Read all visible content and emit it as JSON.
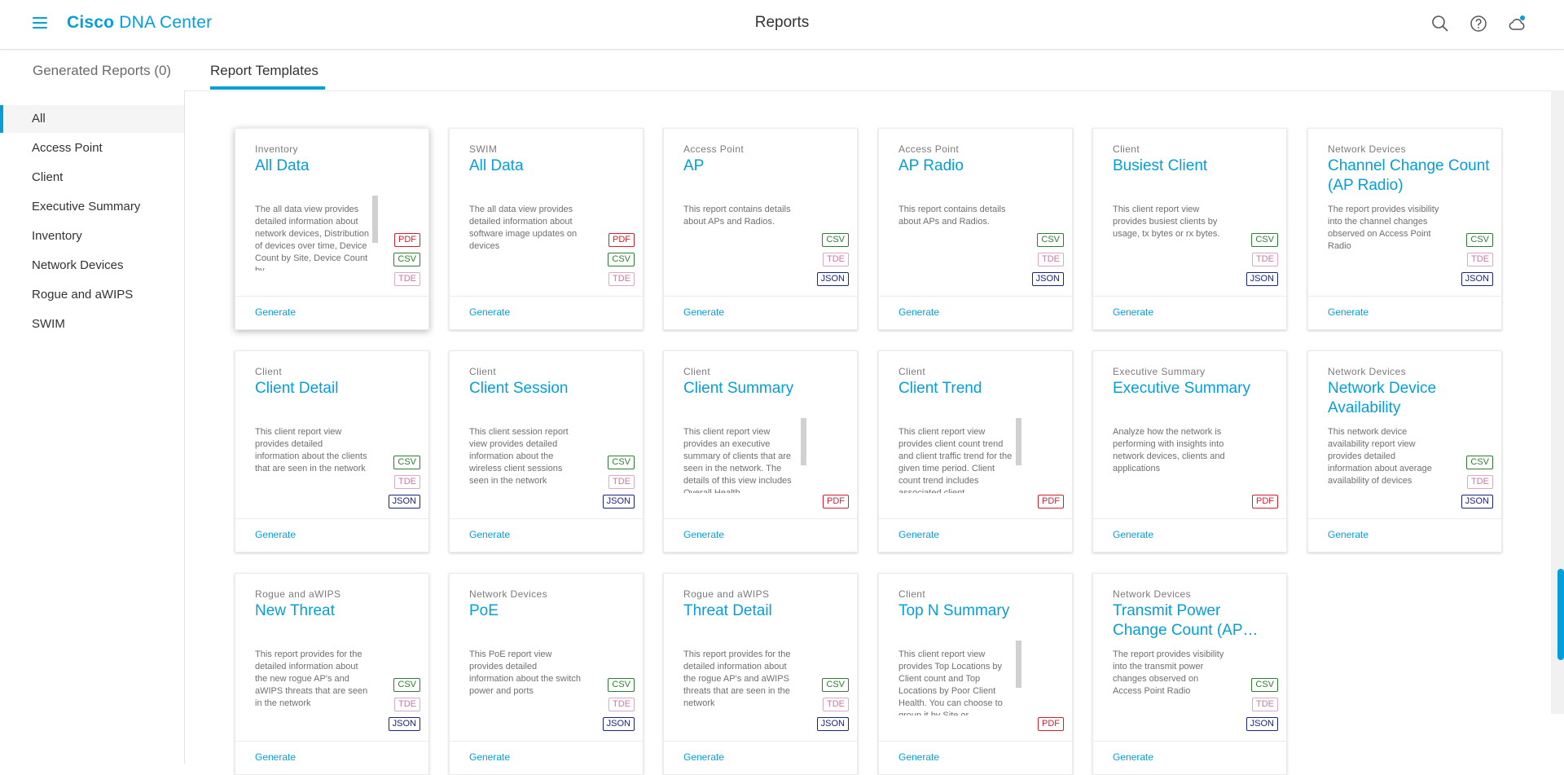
{
  "header": {
    "brand_bold": "Cisco",
    "brand_rest": " DNA Center",
    "page_title": "Reports"
  },
  "icons": {
    "menu": "hamburger-menu-icon",
    "search": "search-icon",
    "help": "help-icon",
    "notifications": "cloud-notification-icon"
  },
  "tabs": [
    {
      "label": "Generated Reports (0)"
    },
    {
      "label": "Report Templates"
    }
  ],
  "sidebar": {
    "items": [
      {
        "label": "All"
      },
      {
        "label": "Access Point"
      },
      {
        "label": "Client"
      },
      {
        "label": "Executive Summary"
      },
      {
        "label": "Inventory"
      },
      {
        "label": "Network Devices"
      },
      {
        "label": "Rogue and aWIPS"
      },
      {
        "label": "SWIM"
      }
    ]
  },
  "colors": {
    "accent": "#049fd9",
    "pdf": "#cf2030",
    "csv": "#2e7d32",
    "tde": "#c678a4",
    "json": "#1a237e"
  },
  "cards": [
    {
      "category": "Inventory",
      "title": "All Data",
      "description": "The all data view provides detailed information about network devices, Distribution of devices over time, Device Count by Site, Device Count by",
      "formats": [
        "PDF",
        "CSV",
        "TDE"
      ],
      "action": "Generate"
    },
    {
      "category": "SWIM",
      "title": "All Data",
      "description": "The all data view provides detailed information about software image updates on devices",
      "formats": [
        "PDF",
        "CSV",
        "TDE"
      ],
      "action": "Generate"
    },
    {
      "category": "Access Point",
      "title": "AP",
      "description": "This report contains details about APs and Radios.",
      "formats": [
        "CSV",
        "TDE",
        "JSON"
      ],
      "action": "Generate"
    },
    {
      "category": "Access Point",
      "title": "AP Radio",
      "description": "This report contains details about APs and Radios.",
      "formats": [
        "CSV",
        "TDE",
        "JSON"
      ],
      "action": "Generate"
    },
    {
      "category": "Client",
      "title": "Busiest Client",
      "description": "This client report view provides busiest clients by usage, tx bytes or rx bytes.",
      "formats": [
        "CSV",
        "TDE",
        "JSON"
      ],
      "action": "Generate"
    },
    {
      "category": "Network Devices",
      "title": "Channel Change Count (AP Radio)",
      "description": "The report provides visibility into the channel changes observed on Access Point Radio",
      "formats": [
        "CSV",
        "TDE",
        "JSON"
      ],
      "action": "Generate"
    },
    {
      "category": "Client",
      "title": "Client Detail",
      "description": "This client report view provides detailed information about the clients that are seen in the network",
      "formats": [
        "CSV",
        "TDE",
        "JSON"
      ],
      "action": "Generate"
    },
    {
      "category": "Client",
      "title": "Client Session",
      "description": "This client session report view provides detailed information about the wireless client sessions seen in the network",
      "formats": [
        "CSV",
        "TDE",
        "JSON"
      ],
      "action": "Generate"
    },
    {
      "category": "Client",
      "title": "Client Summary",
      "description": "This client report view provides an executive summary of clients that are seen in the network. The details of this view includes Overall Health",
      "formats": [
        "PDF"
      ],
      "action": "Generate"
    },
    {
      "category": "Client",
      "title": "Client Trend",
      "description": "This client report view provides client count trend and client traffic trend for the given time period. Client count trend includes associated client",
      "formats": [
        "PDF"
      ],
      "action": "Generate"
    },
    {
      "category": "Executive Summary",
      "title": "Executive Summary",
      "description": "Analyze how the network is performing with insights into network devices, clients and applications",
      "formats": [
        "PDF"
      ],
      "action": "Generate"
    },
    {
      "category": "Network Devices",
      "title": "Network Device Availability",
      "description": "This network device availability report view provides detailed information about average availability of devices",
      "formats": [
        "CSV",
        "TDE",
        "JSON"
      ],
      "action": "Generate"
    },
    {
      "category": "Rogue and aWIPS",
      "title": "New Threat",
      "description": "This report provides for the detailed information about the new rogue AP's and aWIPS threats that are seen in the network",
      "formats": [
        "CSV",
        "TDE",
        "JSON"
      ],
      "action": "Generate"
    },
    {
      "category": "Network Devices",
      "title": "PoE",
      "description": "This PoE report view provides detailed information about the switch power and ports",
      "formats": [
        "CSV",
        "TDE",
        "JSON"
      ],
      "action": "Generate"
    },
    {
      "category": "Rogue and aWIPS",
      "title": "Threat Detail",
      "description": "This report provides for the detailed information about the rogue AP's and aWIPS threats that are seen in the network",
      "formats": [
        "CSV",
        "TDE",
        "JSON"
      ],
      "action": "Generate"
    },
    {
      "category": "Client",
      "title": "Top N Summary",
      "description": "This client report view provides Top Locations by Client count and Top Locations by Poor Client Health. You can choose to group it by Site or",
      "formats": [
        "PDF"
      ],
      "action": "Generate"
    },
    {
      "category": "Network Devices",
      "title": "Transmit Power Change Count (AP…",
      "description": "The report provides visibility into the transmit power changes observed on Access Point Radio",
      "formats": [
        "CSV",
        "TDE",
        "JSON"
      ],
      "action": "Generate"
    }
  ]
}
